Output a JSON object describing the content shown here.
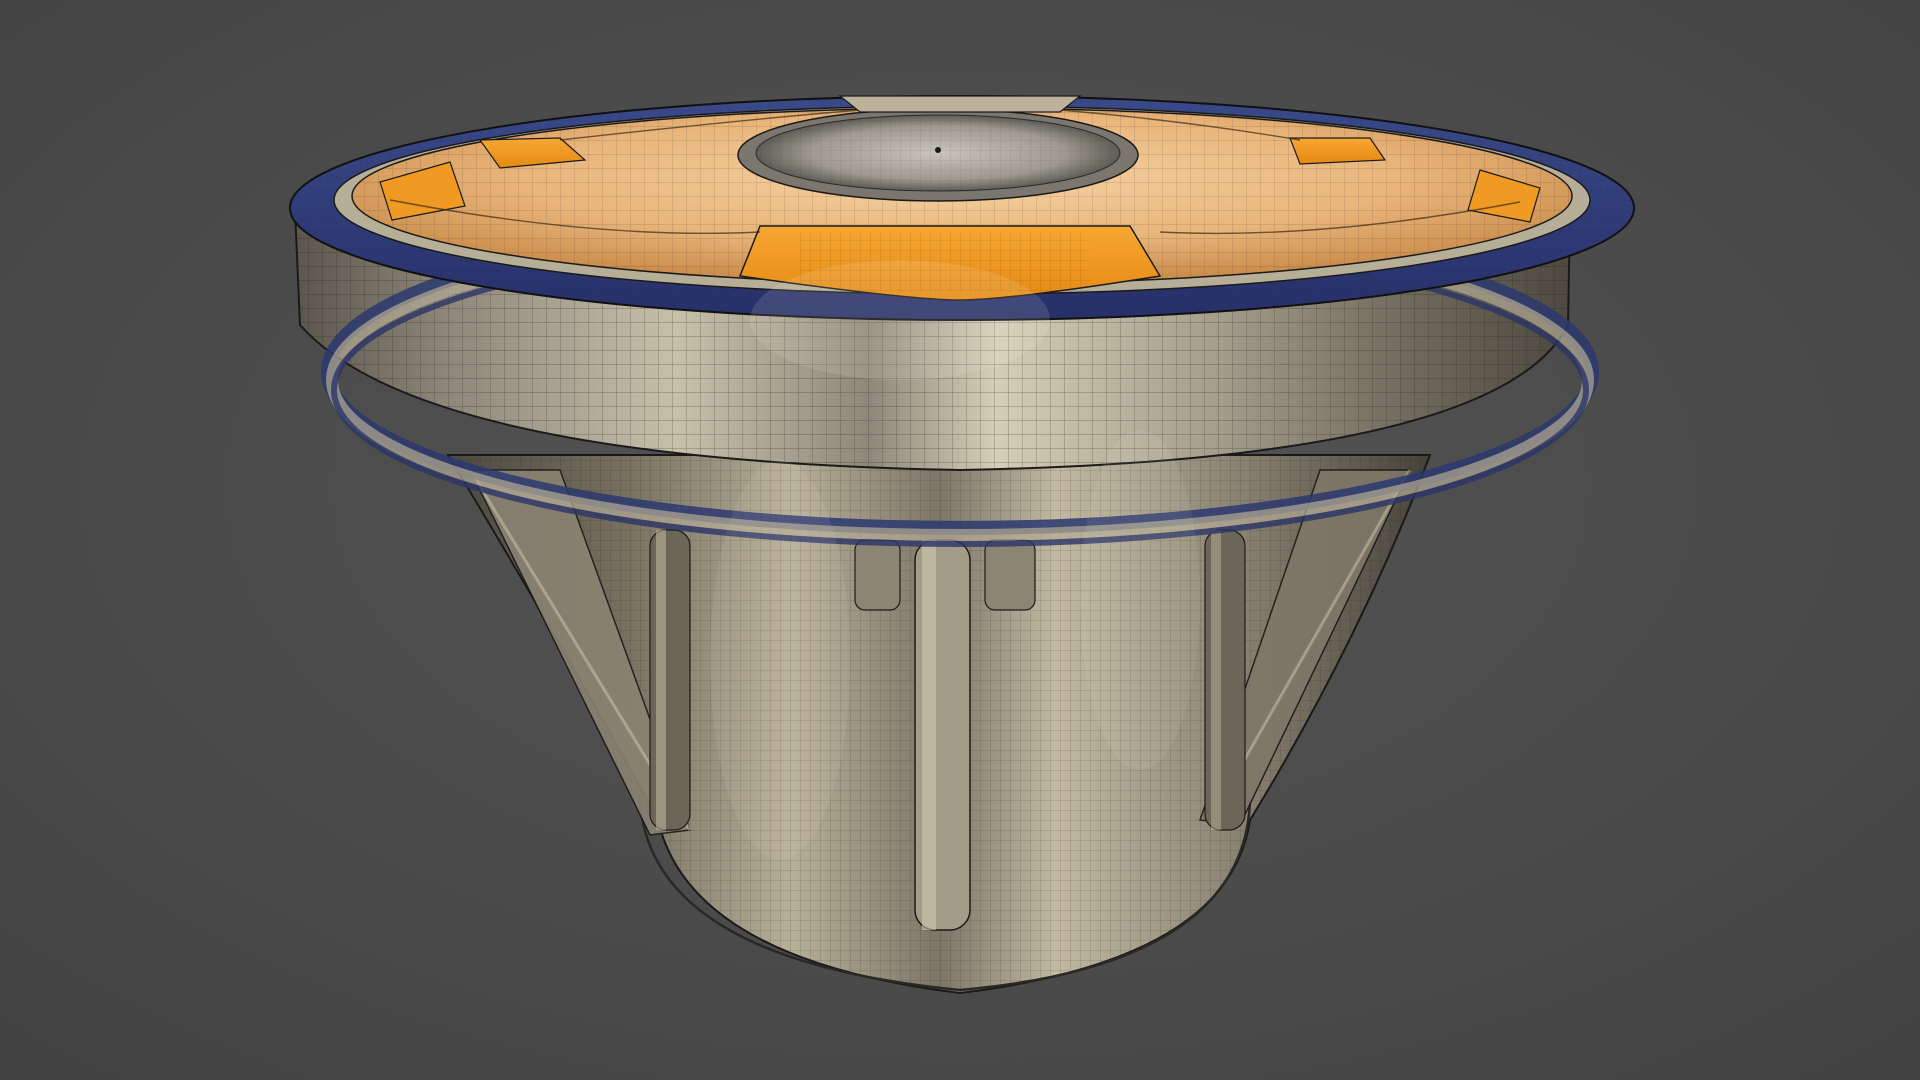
{
  "scene": {
    "subject": "3d-piston-wireframe-render",
    "colors": {
      "background": "#4b4b4b",
      "metal_light": "#d8cfb8",
      "metal_mid": "#9a9280",
      "metal_dark": "#4a463e",
      "rim_blue": "#2f3e78",
      "top_orange_light": "#f0c48a",
      "top_orange": "#f29a1e",
      "wire": "#1a1a1a"
    }
  }
}
